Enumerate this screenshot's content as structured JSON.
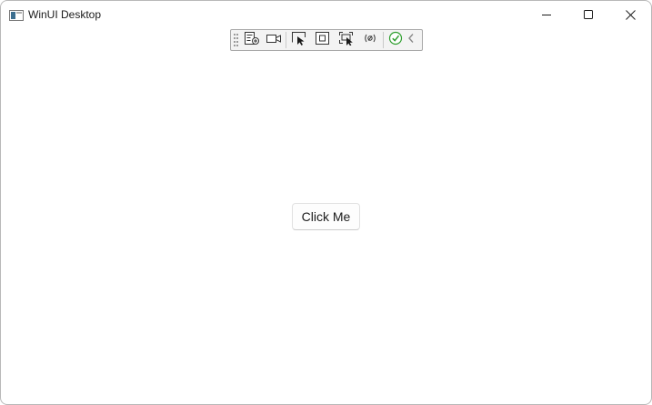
{
  "window": {
    "title": "WinUI Desktop",
    "icon": "app-window-icon",
    "caption_buttons": [
      "minimize-icon",
      "maximize-icon",
      "close-icon"
    ]
  },
  "toolbar": {
    "buttons": [
      {
        "icon": "go-to-live-visual-tree-icon"
      },
      {
        "icon": "record-video-icon"
      },
      {
        "icon": "select-element-icon"
      },
      {
        "icon": "display-layout-adorners-icon"
      },
      {
        "icon": "track-focus-icon"
      },
      {
        "icon": "binding-failures-icon"
      },
      {
        "icon": "hot-reload-status-icon",
        "color": "#2e9e2e"
      },
      {
        "icon": "collapse-toolbar-icon"
      }
    ]
  },
  "content": {
    "button_label": "Click Me"
  }
}
